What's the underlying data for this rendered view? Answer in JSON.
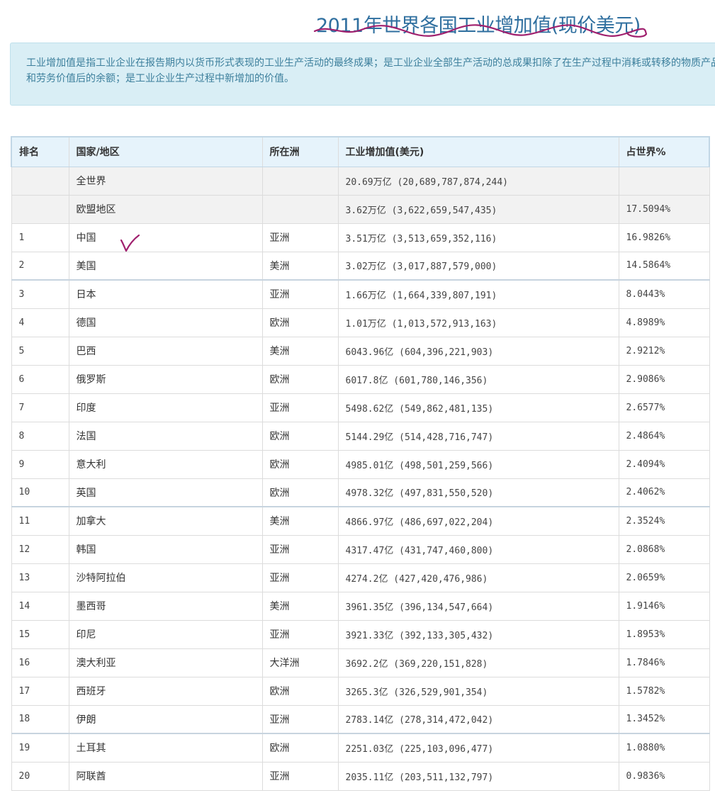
{
  "page": {
    "title": "2011年世界各国工业增加值(现价美元)",
    "description": "工业增加值是指工业企业在报告期内以货币形式表现的工业生产活动的最终成果；是工业企业全部生产活动的总成果扣除了在生产过程中消耗或转移的物质产品和劳务价值后的余额；是工业企业生产过程中新增加的价值。"
  },
  "colors": {
    "title": "#2f6f9f",
    "annotation": "#a0206e",
    "info_background": "#d9eef5",
    "header_background": "#e6f3fb"
  },
  "table": {
    "headers": {
      "rank": "排名",
      "country": "国家/地区",
      "continent": "所在洲",
      "value": "工业增加值(美元)",
      "share": "占世界%"
    },
    "summary_rows": [
      {
        "rank": "",
        "country": "全世界",
        "continent": "",
        "value": "20.69万亿 (20,689,787,874,244)",
        "share": ""
      },
      {
        "rank": "",
        "country": "欧盟地区",
        "continent": "",
        "value": "3.62万亿 (3,622,659,547,435)",
        "share": "17.5094%"
      }
    ],
    "rows": [
      {
        "rank": "1",
        "country": "中国",
        "continent": "亚洲",
        "value": "3.51万亿 (3,513,659,352,116)",
        "share": "16.9826%"
      },
      {
        "rank": "2",
        "country": "美国",
        "continent": "美洲",
        "value": "3.02万亿 (3,017,887,579,000)",
        "share": "14.5864%"
      },
      {
        "rank": "3",
        "country": "日本",
        "continent": "亚洲",
        "value": "1.66万亿 (1,664,339,807,191)",
        "share": "8.0443%"
      },
      {
        "rank": "4",
        "country": "德国",
        "continent": "欧洲",
        "value": "1.01万亿 (1,013,572,913,163)",
        "share": "4.8989%"
      },
      {
        "rank": "5",
        "country": "巴西",
        "continent": "美洲",
        "value": "6043.96亿 (604,396,221,903)",
        "share": "2.9212%"
      },
      {
        "rank": "6",
        "country": "俄罗斯",
        "continent": "欧洲",
        "value": "6017.8亿 (601,780,146,356)",
        "share": "2.9086%"
      },
      {
        "rank": "7",
        "country": "印度",
        "continent": "亚洲",
        "value": "5498.62亿 (549,862,481,135)",
        "share": "2.6577%"
      },
      {
        "rank": "8",
        "country": "法国",
        "continent": "欧洲",
        "value": "5144.29亿 (514,428,716,747)",
        "share": "2.4864%"
      },
      {
        "rank": "9",
        "country": "意大利",
        "continent": "欧洲",
        "value": "4985.01亿 (498,501,259,566)",
        "share": "2.4094%"
      },
      {
        "rank": "10",
        "country": "英国",
        "continent": "欧洲",
        "value": "4978.32亿 (497,831,550,520)",
        "share": "2.4062%"
      },
      {
        "rank": "11",
        "country": "加拿大",
        "continent": "美洲",
        "value": "4866.97亿 (486,697,022,204)",
        "share": "2.3524%"
      },
      {
        "rank": "12",
        "country": "韩国",
        "continent": "亚洲",
        "value": "4317.47亿 (431,747,460,800)",
        "share": "2.0868%"
      },
      {
        "rank": "13",
        "country": "沙特阿拉伯",
        "continent": "亚洲",
        "value": "4274.2亿 (427,420,476,986)",
        "share": "2.0659%"
      },
      {
        "rank": "14",
        "country": "墨西哥",
        "continent": "美洲",
        "value": "3961.35亿 (396,134,547,664)",
        "share": "1.9146%"
      },
      {
        "rank": "15",
        "country": "印尼",
        "continent": "亚洲",
        "value": "3921.33亿 (392,133,305,432)",
        "share": "1.8953%"
      },
      {
        "rank": "16",
        "country": "澳大利亚",
        "continent": "大洋洲",
        "value": "3692.2亿 (369,220,151,828)",
        "share": "1.7846%"
      },
      {
        "rank": "17",
        "country": "西班牙",
        "continent": "欧洲",
        "value": "3265.3亿 (326,529,901,354)",
        "share": "1.5782%"
      },
      {
        "rank": "18",
        "country": "伊朗",
        "continent": "亚洲",
        "value": "2783.14亿 (278,314,472,042)",
        "share": "1.3452%"
      },
      {
        "rank": "19",
        "country": "土耳其",
        "continent": "欧洲",
        "value": "2251.03亿 (225,103,096,477)",
        "share": "1.0880%"
      },
      {
        "rank": "20",
        "country": "阿联酋",
        "continent": "亚洲",
        "value": "2035.11亿 (203,511,132,797)",
        "share": "0.9836%"
      }
    ]
  }
}
